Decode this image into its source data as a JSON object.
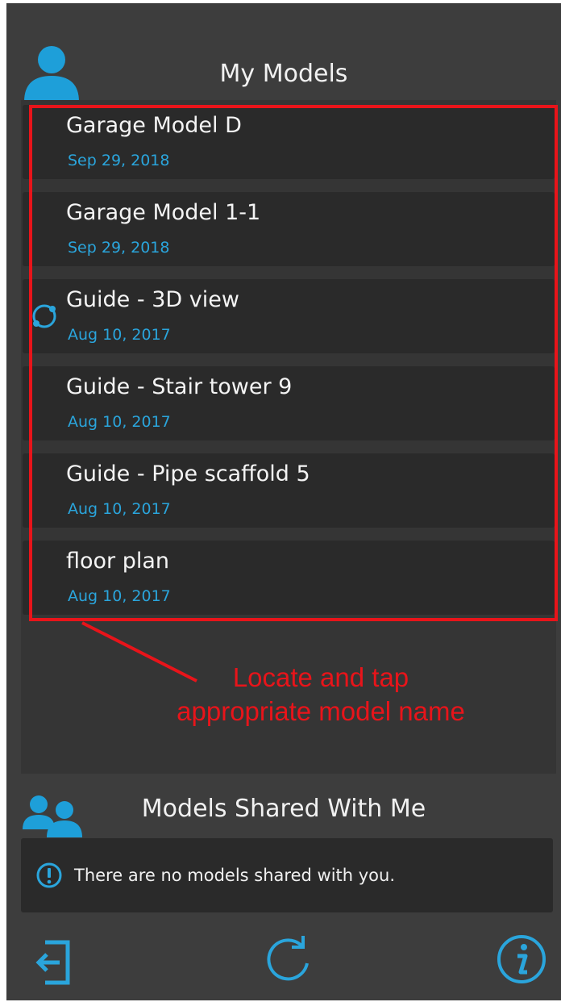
{
  "my_models": {
    "title": "My Models",
    "items": [
      {
        "name": "Garage Model D",
        "date": "Sep 29, 2018",
        "syncing": false
      },
      {
        "name": "Garage Model 1-1",
        "date": "Sep 29, 2018",
        "syncing": false
      },
      {
        "name": "Guide - 3D view",
        "date": "Aug 10, 2017",
        "syncing": true
      },
      {
        "name": "Guide - Stair tower 9",
        "date": "Aug 10, 2017",
        "syncing": false
      },
      {
        "name": "Guide - Pipe scaffold 5",
        "date": "Aug 10, 2017",
        "syncing": false
      },
      {
        "name": "floor plan",
        "date": "Aug 10, 2017",
        "syncing": false
      }
    ]
  },
  "annotation": {
    "line1": "Locate and tap",
    "line2": "appropriate model name"
  },
  "shared": {
    "title": "Models Shared With Me",
    "empty_message": "There are no models shared with you."
  },
  "colors": {
    "accent": "#2aa5dc",
    "annotation": "#e8141a",
    "background": "#3d3d3d",
    "item": "#2a2a2a"
  },
  "icons": {
    "my_models": "user-icon",
    "shared": "users-icon",
    "sync": "sync-icon",
    "warning": "warning-icon",
    "logout": "logout-icon",
    "refresh": "refresh-icon",
    "info": "info-icon"
  }
}
